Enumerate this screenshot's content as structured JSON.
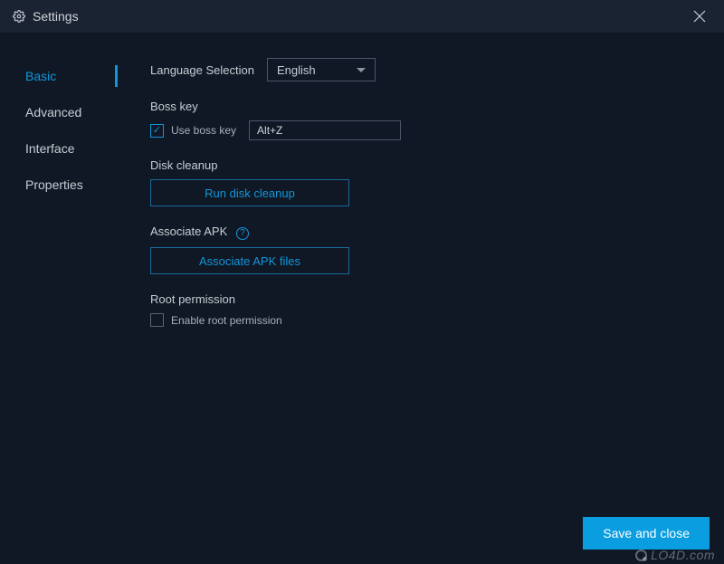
{
  "window": {
    "title": "Settings"
  },
  "sidebar": {
    "items": [
      {
        "label": "Basic",
        "active": true
      },
      {
        "label": "Advanced",
        "active": false
      },
      {
        "label": "Interface",
        "active": false
      },
      {
        "label": "Properties",
        "active": false
      }
    ]
  },
  "main": {
    "language": {
      "label": "Language Selection",
      "value": "English"
    },
    "bosskey": {
      "label": "Boss key",
      "checkbox_label": "Use boss key",
      "checked": true,
      "value": "Alt+Z"
    },
    "disk": {
      "label": "Disk cleanup",
      "button": "Run disk cleanup"
    },
    "apk": {
      "label": "Associate APK",
      "button": "Associate APK files"
    },
    "root": {
      "label": "Root permission",
      "checkbox_label": "Enable root permission",
      "checked": false
    }
  },
  "footer": {
    "save": "Save and close"
  },
  "watermark": "LO4D.com"
}
